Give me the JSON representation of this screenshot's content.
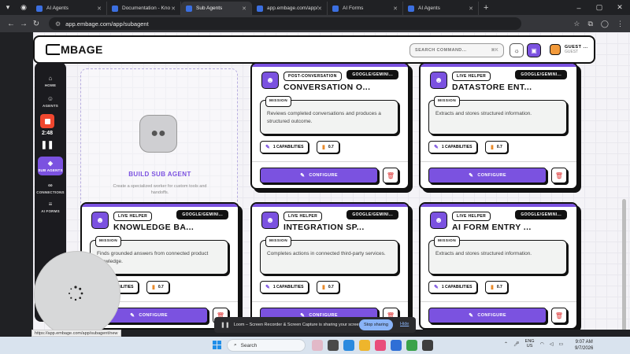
{
  "browser": {
    "tabs": [
      {
        "label": "AI Agents",
        "color": "#3b6fe0"
      },
      {
        "label": "Documentation - Kno",
        "color": "#3b6fe0"
      },
      {
        "label": "Sub Agents",
        "color": "#3b6fe0"
      },
      {
        "label": "app.embage.com/app/",
        "color": "#3b6fe0"
      },
      {
        "label": "AI Forms",
        "color": "#3b6fe0"
      },
      {
        "label": "AI Agents",
        "color": "#3b6fe0"
      }
    ],
    "active_tab": 2,
    "url": "app.embage.com/app/subagent"
  },
  "header": {
    "logo": "MBAGE",
    "search_placeholder": "SEARCH COMMAND...",
    "search_kbd": "⌘K",
    "user_name": "GUEST ...",
    "user_sub": "GUEST"
  },
  "sidebar": {
    "items": [
      {
        "label": "HOME",
        "icon": "home-icon"
      },
      {
        "label": "AGENTS",
        "icon": "robot-icon"
      },
      {
        "label": "SUB AGENTS",
        "icon": "sub-agents-icon"
      },
      {
        "label": "CONNECTIONS",
        "icon": "link-icon"
      },
      {
        "label": "AI FORMS",
        "icon": "database-icon"
      }
    ],
    "active": "SUB AGENTS"
  },
  "recorder": {
    "time": "2:48"
  },
  "build_card": {
    "title": "BUILD SUB AGENT",
    "desc": "Create a specialized worker for custom tools and handoffs."
  },
  "labels": {
    "mission": "MISSION",
    "configure": "CONFIGURE"
  },
  "agents": [
    {
      "tag": "POST-CONVERSATION",
      "model": "GOOGLE/GEMINI...",
      "title": "CONVERSATION O...",
      "mission": "Reviews completed conversations and produces a structured outcome.",
      "caps": "1 CAPABILITIES",
      "temp": "0.7"
    },
    {
      "tag": "LIVE HELPER",
      "model": "GOOGLE/GEMINI...",
      "title": "DATASTORE ENT...",
      "mission": "Extracts and stores structured information.",
      "caps": "1 CAPABILITIES",
      "temp": "0.7"
    },
    {
      "tag": "LIVE HELPER",
      "model": "GOOGLE/GEMINI...",
      "title": "KNOWLEDGE BA...",
      "mission": "Finds grounded answers from connected product knowledge.",
      "caps": "1 CAPABILITIES",
      "temp": "0.7"
    },
    {
      "tag": "LIVE HELPER",
      "model": "GOOGLE/GEMINI...",
      "title": "INTEGRATION SP...",
      "mission": "Completes actions in connected third-party services.",
      "caps": "1 CAPABILITIES",
      "temp": "0.7"
    },
    {
      "tag": "LIVE HELPER",
      "model": "GOOGLE/GEMINI...",
      "title": "AI FORM ENTRY ...",
      "mission": "Extracts and stores structured information.",
      "caps": "1 CAPABILITIES",
      "temp": "0.7"
    }
  ],
  "share_bar": {
    "text": "Loom – Screen Recorder & Screen Capture is sharing your screen.",
    "stop": "Stop sharing",
    "hide": "Hide"
  },
  "status_url": "https://app.embage.com/app/subagent/new",
  "taskbar": {
    "search": "Search",
    "lang1": "ENG",
    "lang2": "US",
    "time": "9:07 AM",
    "date": "9/7/2026"
  },
  "colors": {
    "accent": "#7b52e0",
    "danger": "#dd3333"
  }
}
